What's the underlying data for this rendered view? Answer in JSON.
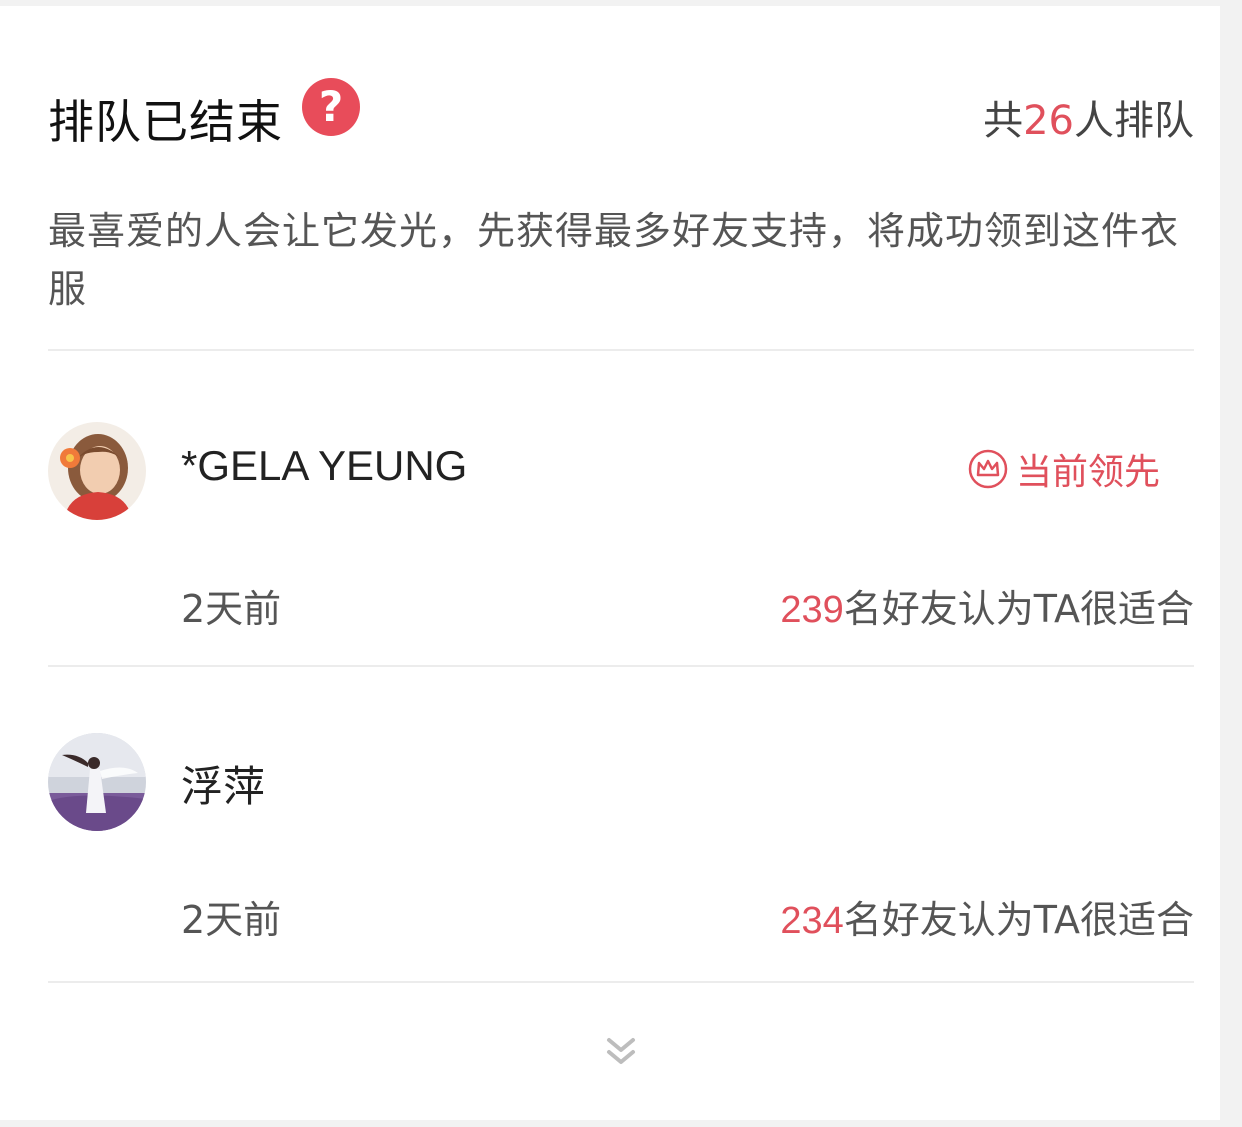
{
  "header": {
    "title": "排队已结束",
    "help_icon_glyph": "?",
    "queue_total_prefix": "共",
    "queue_total_count": "26",
    "queue_total_suffix": "人排队"
  },
  "description": "最喜爱的人会让它发光，先获得最多好友支持，将成功领到这件衣服",
  "entries": [
    {
      "name": "*GELA YEUNG",
      "badge": "当前领先",
      "time": "2天前",
      "votes_count": "239",
      "votes_suffix": "名好友认为TA很适合"
    },
    {
      "name": "浮萍",
      "time": "2天前",
      "votes_count": "234",
      "votes_suffix": "名好友认为TA很适合"
    }
  ],
  "icons": {
    "help": "question-circle-icon",
    "crown": "crown-icon",
    "more": "double-chevron-down-icon"
  },
  "colors": {
    "accent": "#e0505c",
    "help_bg": "#e84c5a",
    "text_primary": "#111111",
    "text_secondary": "#555555",
    "divider": "#ececec",
    "page_bg": "#f2f2f2"
  }
}
